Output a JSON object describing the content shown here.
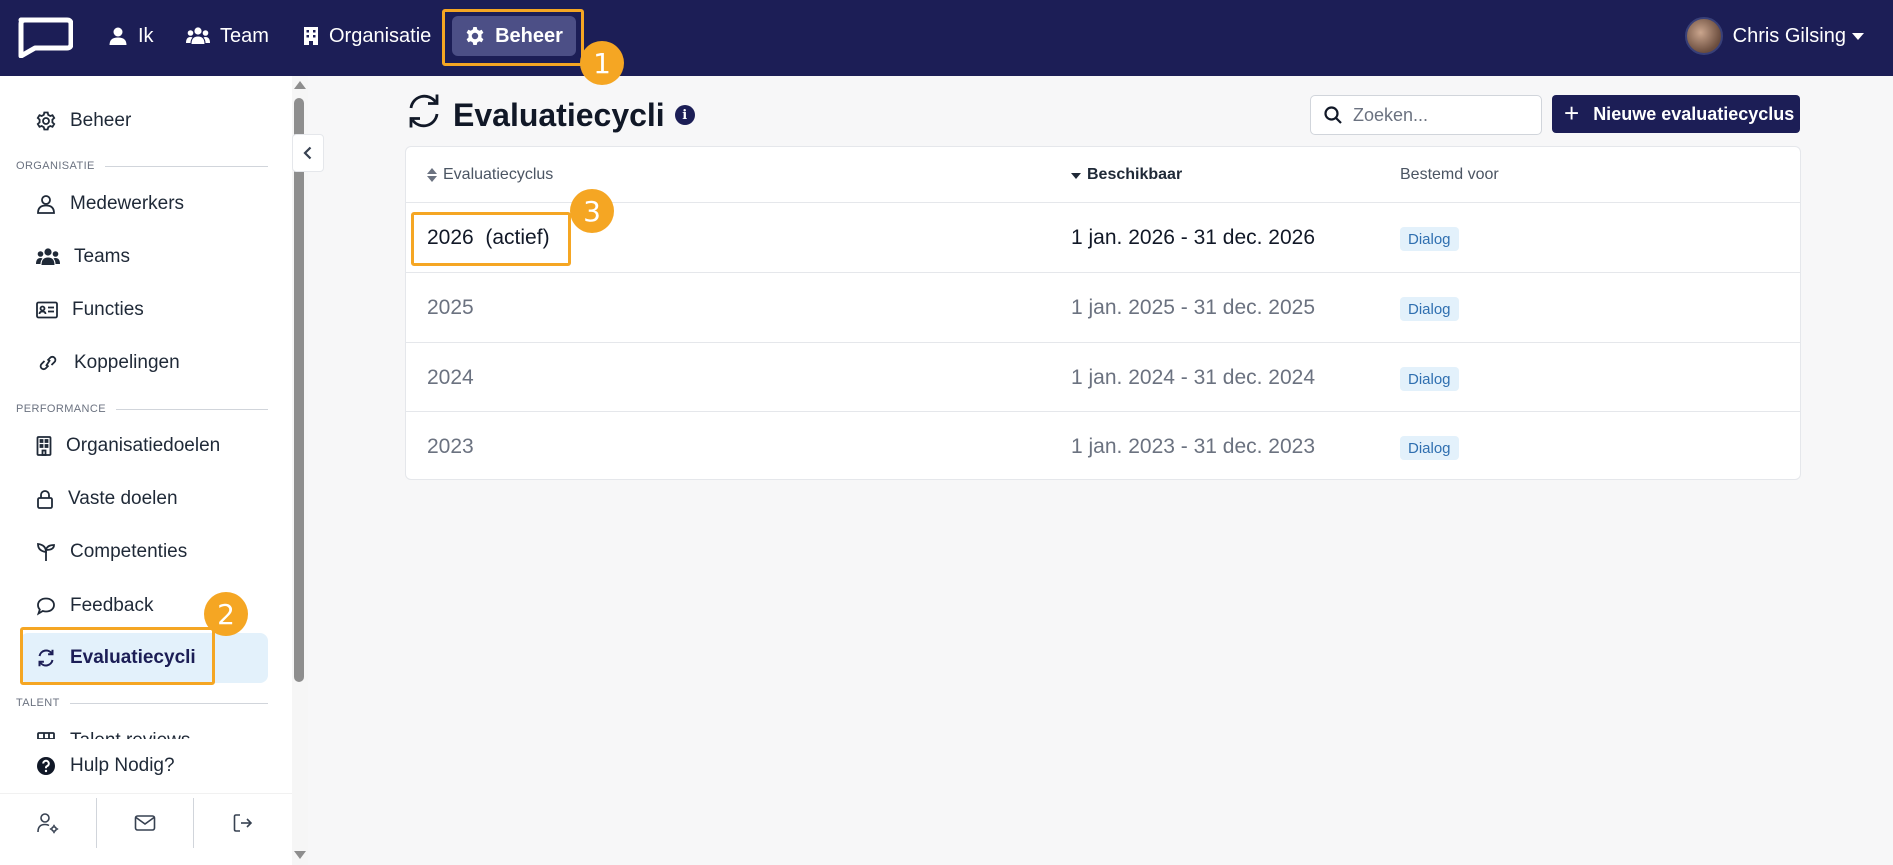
{
  "topnav": {
    "items": [
      {
        "label": "Ik",
        "icon": "user-icon"
      },
      {
        "label": "Team",
        "icon": "users-icon"
      },
      {
        "label": "Organisatie",
        "icon": "building-icon"
      },
      {
        "label": "Beheer",
        "icon": "gear-icon"
      }
    ],
    "user_name": "Chris Gilsing"
  },
  "sidebar": {
    "top_item": "Beheer",
    "sections": {
      "organisatie": "ORGANISATIE",
      "performance": "PERFORMANCE",
      "talent": "TALENT"
    },
    "items": {
      "medewerkers": "Medewerkers",
      "teams": "Teams",
      "functies": "Functies",
      "koppelingen": "Koppelingen",
      "organisatiedoelen": "Organisatiedoelen",
      "vaste_doelen": "Vaste doelen",
      "competenties": "Competenties",
      "feedback": "Feedback",
      "evaluatiecycli": "Evaluatiecycli",
      "talent_reviews": "Talent reviews"
    },
    "help": "Hulp Nodig?"
  },
  "page": {
    "title": "Evaluatiecycli",
    "search_placeholder": "Zoeken...",
    "new_button": "Nieuwe evaluatiecyclus",
    "new_button_plus": "+"
  },
  "table": {
    "headers": {
      "cycle": "Evaluatiecyclus",
      "available": "Beschikbaar",
      "intended": "Bestemd voor"
    },
    "rows": [
      {
        "cycle": "2026  (actief)",
        "range": "1 jan. 2026 - 31 dec. 2026",
        "badge": "Dialog"
      },
      {
        "cycle": "2025",
        "range": "1 jan. 2025 - 31 dec. 2025",
        "badge": "Dialog"
      },
      {
        "cycle": "2024",
        "range": "1 jan. 2024 - 31 dec. 2024",
        "badge": "Dialog"
      },
      {
        "cycle": "2023",
        "range": "1 jan. 2023 - 31 dec. 2023",
        "badge": "Dialog"
      }
    ]
  },
  "annotations": [
    "1",
    "2",
    "3"
  ],
  "colors": {
    "navbar": "#1c1e56",
    "nav_active": "#4c4f86",
    "accent": "#f5a623",
    "badge_bg": "#e3f1fb",
    "badge_text": "#2f6fb0",
    "sidebar_active": "#e3f1fb"
  }
}
